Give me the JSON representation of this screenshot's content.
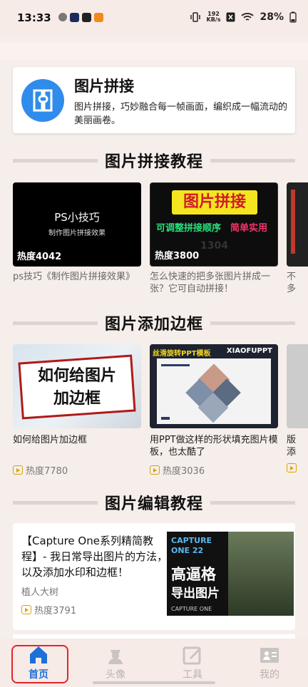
{
  "status_bar": {
    "time": "13:33",
    "net_speed_value": "192",
    "net_speed_unit": "KB/s",
    "battery": "28%"
  },
  "intro": {
    "icon": "puzzle-image-icon",
    "title": "图片拼接",
    "description": "图片拼接，巧妙融合每一帧画面，编织成一幅流动的美丽画卷。"
  },
  "sections": {
    "stitch_tutorials": "图片拼接教程",
    "add_border": "图片添加边框",
    "edit_tutorials": "图片编辑教程"
  },
  "stitch_cards": [
    {
      "thumb_title": "PS小技巧",
      "thumb_sub": "制作图片拼接效果",
      "hot": "热度4042",
      "title": "ps技巧《制作图片拼接效果》"
    },
    {
      "thumb_title": "图片拼接",
      "thumb_sub1": "可调整拼接顺序",
      "thumb_sub2": "简单实用",
      "thumb_num": "1304",
      "hot": "热度3800",
      "title": "怎么快速的把多张图片拼成一张？它可自动拼接！"
    },
    {
      "title_peek": "不",
      "title_peek2": "多"
    }
  ],
  "border_cards": [
    {
      "thumb_line1": "如何给图片",
      "thumb_line2": "加边框",
      "title": "如何给图片加边框",
      "hot": "热度7780"
    },
    {
      "thumb_banner": "丝滑旋转PPT模板",
      "thumb_brand": "XIAOFUPPT",
      "title": "用PPT做这样的形状填充图片模板，也太酷了",
      "hot": "热度3036"
    },
    {
      "title_peek": "版",
      "title_peek2": "添"
    }
  ],
  "edit_card": {
    "title": "【Capture One系列精简教程】- 我日常导出图片的方法，以及添加水印和边框！",
    "author": "植人大树",
    "hot": "热度3791",
    "thumb_brand_top": "CAPTURE",
    "thumb_brand_bottom": "ONE 22",
    "thumb_line1": "高逼格",
    "thumb_line2": "导出图片",
    "thumb_footer": "CAPTURE ONE"
  },
  "tabs": [
    {
      "label": "首页",
      "icon": "home-icon"
    },
    {
      "label": "头像",
      "icon": "avatar-icon"
    },
    {
      "label": "工具",
      "icon": "tools-icon"
    },
    {
      "label": "我的",
      "icon": "profile-card-icon"
    }
  ]
}
